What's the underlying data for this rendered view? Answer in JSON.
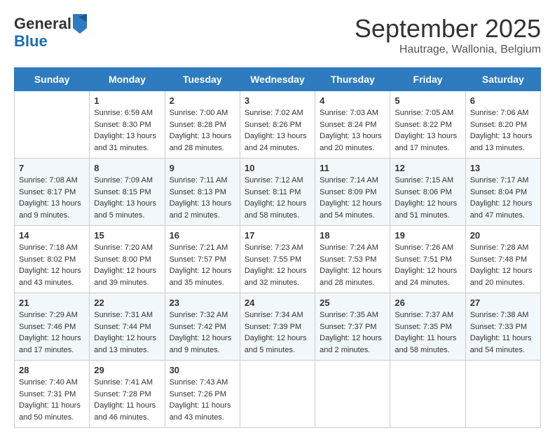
{
  "header": {
    "logo_general": "General",
    "logo_blue": "Blue",
    "title": "September 2025",
    "location": "Hautrage, Wallonia, Belgium"
  },
  "days_of_week": [
    "Sunday",
    "Monday",
    "Tuesday",
    "Wednesday",
    "Thursday",
    "Friday",
    "Saturday"
  ],
  "weeks": [
    [
      {
        "day": "",
        "info": ""
      },
      {
        "day": "1",
        "info": "Sunrise: 6:59 AM\nSunset: 8:30 PM\nDaylight: 13 hours\nand 31 minutes."
      },
      {
        "day": "2",
        "info": "Sunrise: 7:00 AM\nSunset: 8:28 PM\nDaylight: 13 hours\nand 28 minutes."
      },
      {
        "day": "3",
        "info": "Sunrise: 7:02 AM\nSunset: 8:26 PM\nDaylight: 13 hours\nand 24 minutes."
      },
      {
        "day": "4",
        "info": "Sunrise: 7:03 AM\nSunset: 8:24 PM\nDaylight: 13 hours\nand 20 minutes."
      },
      {
        "day": "5",
        "info": "Sunrise: 7:05 AM\nSunset: 8:22 PM\nDaylight: 13 hours\nand 17 minutes."
      },
      {
        "day": "6",
        "info": "Sunrise: 7:06 AM\nSunset: 8:20 PM\nDaylight: 13 hours\nand 13 minutes."
      }
    ],
    [
      {
        "day": "7",
        "info": "Sunrise: 7:08 AM\nSunset: 8:17 PM\nDaylight: 13 hours\nand 9 minutes."
      },
      {
        "day": "8",
        "info": "Sunrise: 7:09 AM\nSunset: 8:15 PM\nDaylight: 13 hours\nand 5 minutes."
      },
      {
        "day": "9",
        "info": "Sunrise: 7:11 AM\nSunset: 8:13 PM\nDaylight: 13 hours\nand 2 minutes."
      },
      {
        "day": "10",
        "info": "Sunrise: 7:12 AM\nSunset: 8:11 PM\nDaylight: 12 hours\nand 58 minutes."
      },
      {
        "day": "11",
        "info": "Sunrise: 7:14 AM\nSunset: 8:09 PM\nDaylight: 12 hours\nand 54 minutes."
      },
      {
        "day": "12",
        "info": "Sunrise: 7:15 AM\nSunset: 8:06 PM\nDaylight: 12 hours\nand 51 minutes."
      },
      {
        "day": "13",
        "info": "Sunrise: 7:17 AM\nSunset: 8:04 PM\nDaylight: 12 hours\nand 47 minutes."
      }
    ],
    [
      {
        "day": "14",
        "info": "Sunrise: 7:18 AM\nSunset: 8:02 PM\nDaylight: 12 hours\nand 43 minutes."
      },
      {
        "day": "15",
        "info": "Sunrise: 7:20 AM\nSunset: 8:00 PM\nDaylight: 12 hours\nand 39 minutes."
      },
      {
        "day": "16",
        "info": "Sunrise: 7:21 AM\nSunset: 7:57 PM\nDaylight: 12 hours\nand 35 minutes."
      },
      {
        "day": "17",
        "info": "Sunrise: 7:23 AM\nSunset: 7:55 PM\nDaylight: 12 hours\nand 32 minutes."
      },
      {
        "day": "18",
        "info": "Sunrise: 7:24 AM\nSunset: 7:53 PM\nDaylight: 12 hours\nand 28 minutes."
      },
      {
        "day": "19",
        "info": "Sunrise: 7:26 AM\nSunset: 7:51 PM\nDaylight: 12 hours\nand 24 minutes."
      },
      {
        "day": "20",
        "info": "Sunrise: 7:28 AM\nSunset: 7:48 PM\nDaylight: 12 hours\nand 20 minutes."
      }
    ],
    [
      {
        "day": "21",
        "info": "Sunrise: 7:29 AM\nSunset: 7:46 PM\nDaylight: 12 hours\nand 17 minutes."
      },
      {
        "day": "22",
        "info": "Sunrise: 7:31 AM\nSunset: 7:44 PM\nDaylight: 12 hours\nand 13 minutes."
      },
      {
        "day": "23",
        "info": "Sunrise: 7:32 AM\nSunset: 7:42 PM\nDaylight: 12 hours\nand 9 minutes."
      },
      {
        "day": "24",
        "info": "Sunrise: 7:34 AM\nSunset: 7:39 PM\nDaylight: 12 hours\nand 5 minutes."
      },
      {
        "day": "25",
        "info": "Sunrise: 7:35 AM\nSunset: 7:37 PM\nDaylight: 12 hours\nand 2 minutes."
      },
      {
        "day": "26",
        "info": "Sunrise: 7:37 AM\nSunset: 7:35 PM\nDaylight: 11 hours\nand 58 minutes."
      },
      {
        "day": "27",
        "info": "Sunrise: 7:38 AM\nSunset: 7:33 PM\nDaylight: 11 hours\nand 54 minutes."
      }
    ],
    [
      {
        "day": "28",
        "info": "Sunrise: 7:40 AM\nSunset: 7:31 PM\nDaylight: 11 hours\nand 50 minutes."
      },
      {
        "day": "29",
        "info": "Sunrise: 7:41 AM\nSunset: 7:28 PM\nDaylight: 11 hours\nand 46 minutes."
      },
      {
        "day": "30",
        "info": "Sunrise: 7:43 AM\nSunset: 7:26 PM\nDaylight: 11 hours\nand 43 minutes."
      },
      {
        "day": "",
        "info": ""
      },
      {
        "day": "",
        "info": ""
      },
      {
        "day": "",
        "info": ""
      },
      {
        "day": "",
        "info": ""
      }
    ]
  ]
}
